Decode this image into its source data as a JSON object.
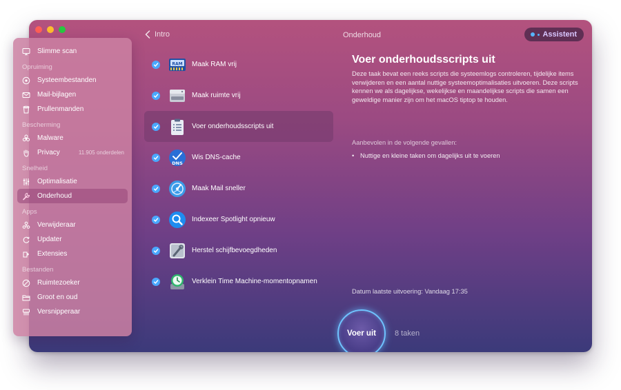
{
  "window": {
    "back_label": "Intro",
    "title": "Onderhoud",
    "assistant_label": "Assistent"
  },
  "sidebar": {
    "top": {
      "label": "Slimme scan",
      "icon": "monitor-icon"
    },
    "sections": [
      {
        "title": "Opruiming",
        "items": [
          {
            "label": "Systeembestanden",
            "icon": "system-junk-icon"
          },
          {
            "label": "Mail-bijlagen",
            "icon": "mail-icon"
          },
          {
            "label": "Prullenmanden",
            "icon": "trash-icon"
          }
        ]
      },
      {
        "title": "Bescherming",
        "items": [
          {
            "label": "Malware",
            "icon": "biohazard-icon"
          },
          {
            "label": "Privacy",
            "icon": "hand-icon",
            "extra": "11.905 onderdelen"
          }
        ]
      },
      {
        "title": "Snelheid",
        "items": [
          {
            "label": "Optimalisatie",
            "icon": "sliders-icon"
          },
          {
            "label": "Onderhoud",
            "icon": "wrench-icon"
          }
        ]
      },
      {
        "title": "Apps",
        "items": [
          {
            "label": "Verwijderaar",
            "icon": "uninstaller-icon"
          },
          {
            "label": "Updater",
            "icon": "updater-icon"
          },
          {
            "label": "Extensies",
            "icon": "extensions-icon"
          }
        ]
      },
      {
        "title": "Bestanden",
        "items": [
          {
            "label": "Ruimtezoeker",
            "icon": "space-lens-icon"
          },
          {
            "label": "Groot en oud",
            "icon": "folder-icon"
          },
          {
            "label": "Versnipperaar",
            "icon": "shredder-icon"
          }
        ]
      }
    ]
  },
  "tasks": [
    {
      "label": "Maak RAM vrij",
      "icon": "ram-icon",
      "checked": true
    },
    {
      "label": "Maak ruimte vrij",
      "icon": "disk-drive-icon",
      "checked": true
    },
    {
      "label": "Voer onderhoudsscripts uit",
      "icon": "clipboard-icon",
      "checked": true,
      "selected": true
    },
    {
      "label": "Wis DNS-cache",
      "icon": "dns-icon",
      "checked": true
    },
    {
      "label": "Maak Mail sneller",
      "icon": "mail-speed-icon",
      "checked": true
    },
    {
      "label": "Indexeer Spotlight opnieuw",
      "icon": "spotlight-icon",
      "checked": true
    },
    {
      "label": "Herstel schijfbevoegdheden",
      "icon": "disk-repair-icon",
      "checked": true
    },
    {
      "label": "Verklein Time Machine-momentopnamen",
      "icon": "time-machine-icon",
      "checked": true
    }
  ],
  "detail": {
    "title": "Voer onderhoudsscripts uit",
    "description": "Deze taak bevat een reeks scripts die systeemlogs controleren, tijdelijke items verwijderen en een aantal nuttige systeemoptimalisaties uitvoeren. Deze scripts kennen we als dagelijkse, wekelijkse en maandelijkse scripts die samen een geweldige manier zijn om het macOS tiptop te houden.",
    "recommend_label": "Aanbevolen in de volgende gevallen:",
    "recommend_items": [
      "Nuttige en kleine taken om dagelijks uit te voeren"
    ],
    "last_run_label": "Datum laatste uitvoering:",
    "last_run_value": "Vandaag 17:35"
  },
  "run": {
    "button_label": "Voer uit",
    "count_label": "8 taken"
  },
  "colors": {
    "accent": "#4aa8ff",
    "run_ring": "#6fc3ff"
  }
}
